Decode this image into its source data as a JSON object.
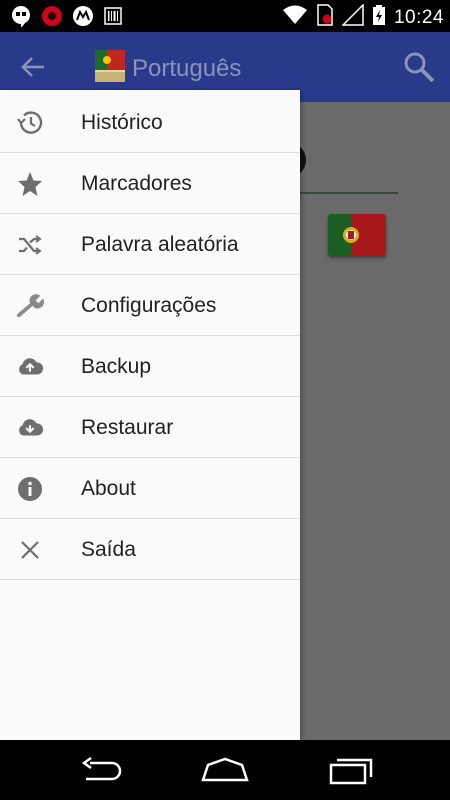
{
  "status_bar": {
    "time": "10:24",
    "icons": [
      "hangouts-icon",
      "record-icon",
      "motorola-icon",
      "barcode-icon",
      "wifi-icon",
      "sim-icon",
      "signal-icon",
      "battery-icon"
    ]
  },
  "app_bar": {
    "title": "Português",
    "back_icon": "arrow-back-icon",
    "search_icon": "search-icon"
  },
  "drawer": {
    "items": [
      {
        "label": "Histórico",
        "icon": "history-icon"
      },
      {
        "label": "Marcadores",
        "icon": "star-icon"
      },
      {
        "label": "Palavra aleatória",
        "icon": "shuffle-icon"
      },
      {
        "label": "Configurações",
        "icon": "wrench-icon"
      },
      {
        "label": "Backup",
        "icon": "cloud-upload-icon"
      },
      {
        "label": "Restaurar",
        "icon": "cloud-download-icon"
      },
      {
        "label": "About",
        "icon": "info-icon"
      },
      {
        "label": "Saída",
        "icon": "close-icon"
      }
    ]
  },
  "colors": {
    "app_bar": "#2a3a8b",
    "drawer_bg": "#fafafa",
    "scrim": "#6a6a6a",
    "icon_gray": "#6e6e6e"
  },
  "nav_bar": {
    "buttons": [
      "back-nav-icon",
      "home-nav-icon",
      "recents-nav-icon"
    ]
  }
}
